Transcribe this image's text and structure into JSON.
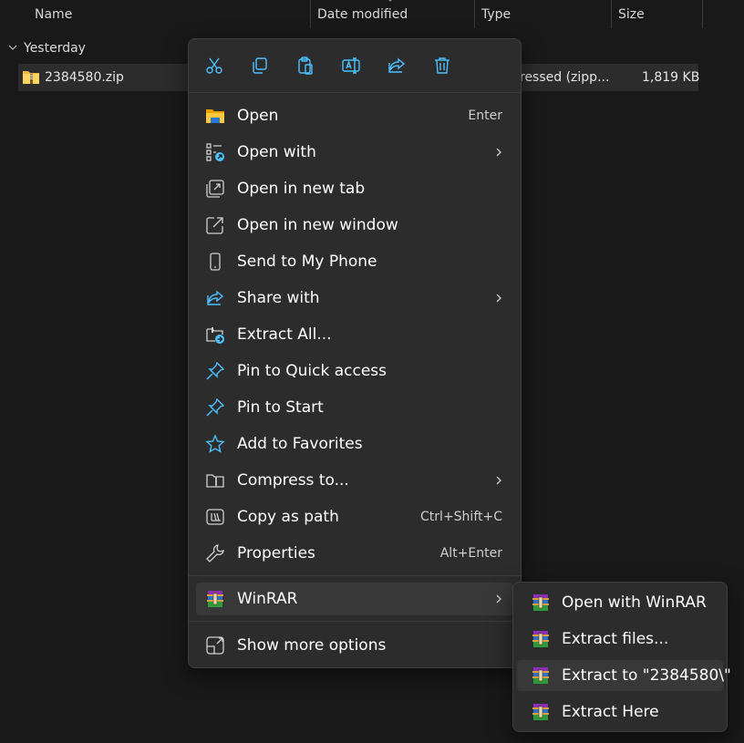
{
  "explorer": {
    "columns": {
      "name": "Name",
      "date_modified": "Date modified",
      "type": "Type",
      "size": "Size"
    },
    "group_label": "Yesterday",
    "file": {
      "name": "2384580.zip",
      "type": "ressed (zipp...",
      "size": "1,819 KB"
    }
  },
  "context_menu": {
    "toolbar_icons": [
      "cut-icon",
      "copy-icon",
      "paste-icon",
      "rename-icon",
      "share-icon",
      "delete-icon"
    ],
    "items": [
      {
        "label": "Open",
        "shortcut": "Enter",
        "icon": "folder-icon"
      },
      {
        "label": "Open with",
        "shortcut": "",
        "icon": "open-with-icon",
        "submenu": true
      },
      {
        "label": "Open in new tab",
        "shortcut": "",
        "icon": "new-tab-icon"
      },
      {
        "label": "Open in new window",
        "shortcut": "",
        "icon": "new-window-icon"
      },
      {
        "label": "Send to My Phone",
        "shortcut": "",
        "icon": "phone-icon"
      },
      {
        "label": "Share with",
        "shortcut": "",
        "icon": "share-icon",
        "submenu": true
      },
      {
        "label": "Extract All...",
        "shortcut": "",
        "icon": "extract-all-icon"
      },
      {
        "label": "Pin to Quick access",
        "shortcut": "",
        "icon": "pin-icon"
      },
      {
        "label": "Pin to Start",
        "shortcut": "",
        "icon": "pin-icon"
      },
      {
        "label": "Add to Favorites",
        "shortcut": "",
        "icon": "star-icon"
      },
      {
        "label": "Compress to...",
        "shortcut": "",
        "icon": "compress-icon",
        "submenu": true
      },
      {
        "label": "Copy as path",
        "shortcut": "Ctrl+Shift+C",
        "icon": "copy-path-icon"
      },
      {
        "label": "Properties",
        "shortcut": "Alt+Enter",
        "icon": "wrench-icon"
      }
    ],
    "winrar": {
      "label": "WinRAR",
      "icon": "winrar-icon",
      "submenu": true
    },
    "more": {
      "label": "Show more options",
      "icon": "more-options-icon"
    }
  },
  "winrar_submenu": {
    "items": [
      {
        "label": "Open with WinRAR"
      },
      {
        "label": "Extract files..."
      },
      {
        "label": "Extract to \"2384580\\\""
      },
      {
        "label": "Extract Here"
      }
    ]
  },
  "colors": {
    "background": "#191919",
    "menu_background": "#2c2c2c",
    "highlight": "#383838",
    "icon_accent": "#4cc2ff"
  }
}
